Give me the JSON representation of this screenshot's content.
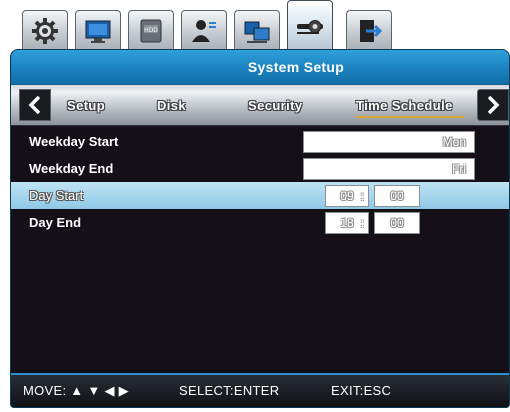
{
  "tabs": [
    {
      "icon": "gear-icon"
    },
    {
      "icon": "monitor-icon"
    },
    {
      "icon": "hdd-icon",
      "label": "HDD"
    },
    {
      "icon": "users-icon"
    },
    {
      "icon": "network-icon"
    },
    {
      "icon": "system-settings-icon",
      "active": true
    },
    {
      "icon": "exit-icon"
    }
  ],
  "dialog": {
    "title": "System Setup"
  },
  "subtabs": [
    {
      "label": "Setup"
    },
    {
      "label": "Disk"
    },
    {
      "label": "Security"
    },
    {
      "label": "Time Schedule",
      "active": true
    }
  ],
  "rows": {
    "weekday_start": {
      "label": "Weekday Start",
      "value": "Mon"
    },
    "weekday_end": {
      "label": "Weekday End",
      "value": "Fri"
    },
    "day_start": {
      "label": "Day Start",
      "hour": "09",
      "minute": "00",
      "separator": ":"
    },
    "day_end": {
      "label": "Day End",
      "hour": "18",
      "minute": "00",
      "separator": ":"
    }
  },
  "footer": {
    "move": "MOVE: ▲ ▼ ◀ ▶",
    "select": "SELECT:ENTER",
    "exit": "EXIT:ESC"
  },
  "colors": {
    "title_bar": "#1b82bf",
    "highlight_row": "#a6d6ee",
    "panel_background": "#151018",
    "active_tab_underline": "#d9a63a"
  }
}
